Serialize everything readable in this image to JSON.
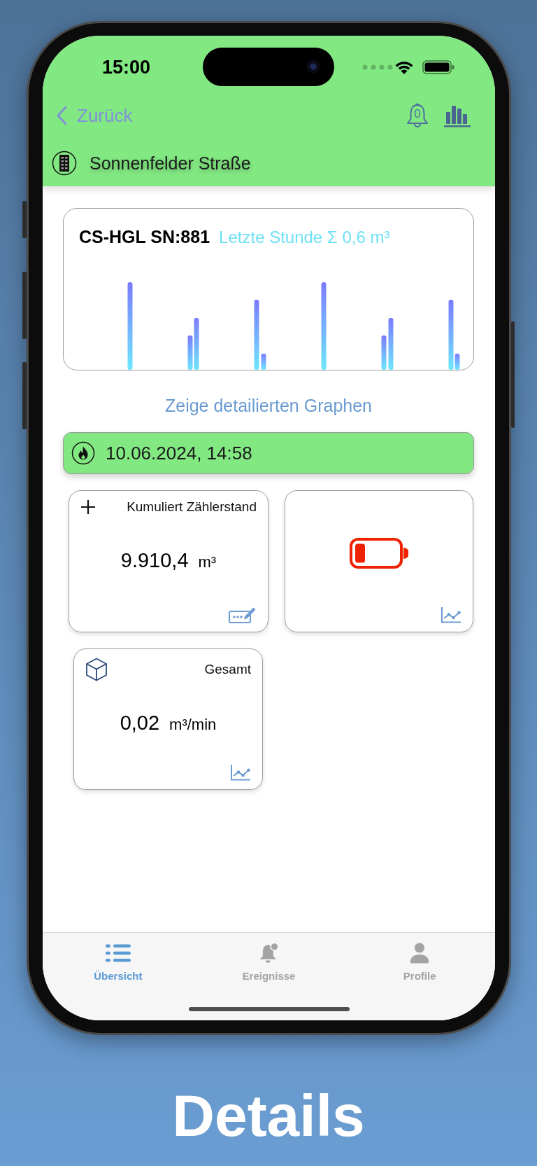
{
  "status_bar": {
    "time": "15:00"
  },
  "nav": {
    "back_label": "Zurück",
    "bell_count": "0"
  },
  "location": {
    "name": "Sonnenfelder Straße"
  },
  "chart_card": {
    "device": "CS-HGL SN:881",
    "summary": "Letzte Stunde Σ 0,6 m³"
  },
  "detail_link": {
    "label": "Zeige detailierten Graphen"
  },
  "reading_bar": {
    "timestamp": "10.06.2024, 14:58"
  },
  "tiles": [
    {
      "kind": "counter",
      "title": "Kumuliert Zählerstand",
      "value": "9.910,4",
      "unit": "m³"
    },
    {
      "kind": "battery"
    },
    {
      "kind": "flow",
      "title": "Gesamt",
      "value": "0,02",
      "unit": "m³/min"
    }
  ],
  "tab_bar": [
    {
      "label": "Übersicht",
      "selected": true
    },
    {
      "label": "Ereignisse",
      "selected": false
    },
    {
      "label": "Profile",
      "selected": false
    }
  ],
  "caption": "Details"
}
